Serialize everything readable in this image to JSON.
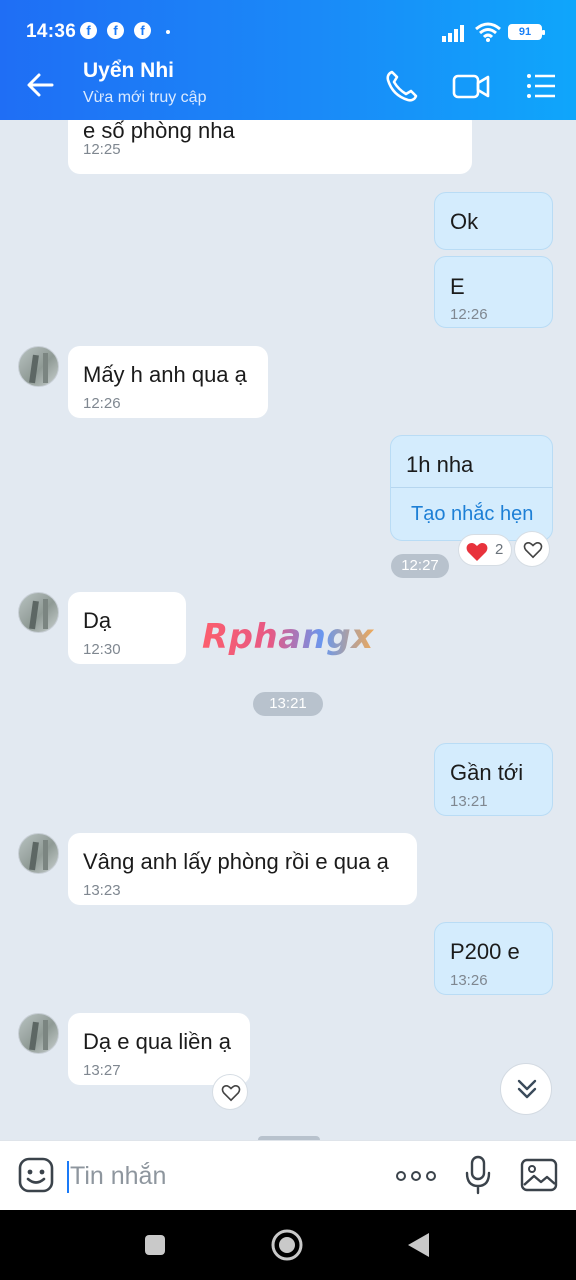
{
  "status_bar": {
    "time": "14:36",
    "battery": "91",
    "fb_glyph": "f"
  },
  "header": {
    "name": "Uyển Nhi",
    "status": "Vừa mới truy cập"
  },
  "messages": {
    "m1": {
      "text": "e số phòng nha",
      "time": "12:25"
    },
    "m2": {
      "text": "Ok"
    },
    "m3": {
      "text": "E",
      "time": "12:26"
    },
    "m4": {
      "text": "Mấy h anh qua ạ",
      "time": "12:26"
    },
    "m5": {
      "text": "1h nha",
      "action": "Tạo nhắc hẹn",
      "time": "12:27",
      "reaction_count": "2"
    },
    "m6": {
      "text": "Dạ",
      "time": "12:30"
    },
    "m7": {
      "text": "Gần tới",
      "time": "13:21"
    },
    "m8": {
      "text": "Vâng anh lấy phòng rồi e qua ạ",
      "time": "13:23"
    },
    "m9": {
      "text": "P200 e",
      "time": "13:26"
    },
    "m10": {
      "text": "Dạ e qua liền ạ",
      "time": "13:27"
    }
  },
  "separators": {
    "s1": "13:21"
  },
  "watermark": "Rphangx",
  "composer": {
    "placeholder": "Tin nhắn"
  },
  "colors": {
    "header_start": "#1f6ef5",
    "header_end": "#0fa6fb",
    "outgoing_bubble": "#d4ecfd",
    "chat_bg": "#e2e9f1",
    "link": "#1d7fd6"
  },
  "icons": [
    "back-arrow-icon",
    "phone-icon",
    "video-call-icon",
    "menu-list-icon",
    "heart-icon",
    "chevron-double-down-icon",
    "sticker-icon",
    "more-dots-icon",
    "microphone-icon",
    "image-gallery-icon"
  ]
}
